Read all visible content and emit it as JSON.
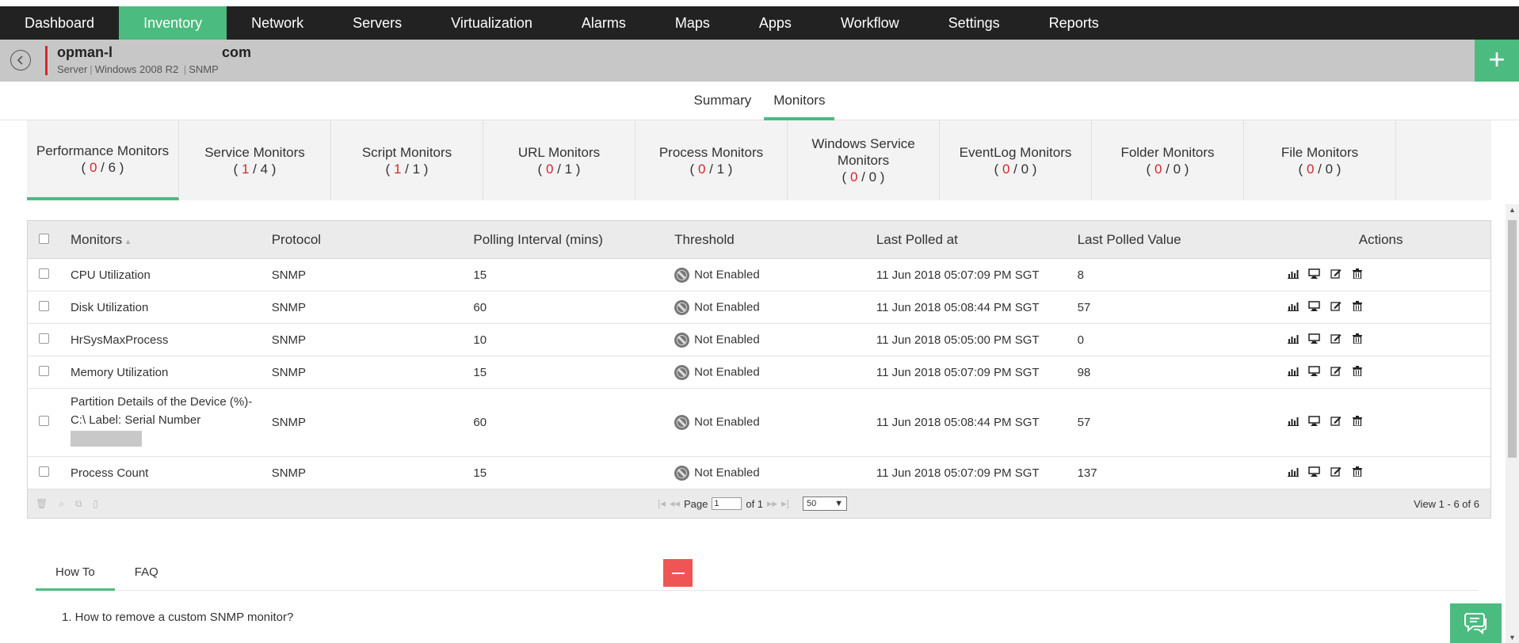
{
  "nav": [
    "Dashboard",
    "Inventory",
    "Network",
    "Servers",
    "Virtualization",
    "Alarms",
    "Maps",
    "Apps",
    "Workflow",
    "Settings",
    "Reports"
  ],
  "device": {
    "name_prefix": "opman-l",
    "name_suffix": "com",
    "type": "Server",
    "os": "Windows 2008 R2",
    "protocol": "SNMP"
  },
  "subtabs": [
    "Summary",
    "Monitors"
  ],
  "monitor_tabs": [
    {
      "label": "Performance Monitors",
      "active": "0",
      "total": "6"
    },
    {
      "label": "Service Monitors",
      "active": "1",
      "total": "4"
    },
    {
      "label": "Script Monitors",
      "active": "1",
      "total": "1"
    },
    {
      "label": "URL Monitors",
      "active": "0",
      "total": "1"
    },
    {
      "label": "Process Monitors",
      "active": "0",
      "total": "1"
    },
    {
      "label": "Windows Service Monitors",
      "active": "0",
      "total": "0"
    },
    {
      "label": "EventLog Monitors",
      "active": "0",
      "total": "0"
    },
    {
      "label": "Folder Monitors",
      "active": "0",
      "total": "0"
    },
    {
      "label": "File Monitors",
      "active": "0",
      "total": "0"
    }
  ],
  "table": {
    "headers": [
      "Monitors",
      "Protocol",
      "Polling Interval (mins)",
      "Threshold",
      "Last Polled at",
      "Last Polled Value",
      "Actions"
    ],
    "rows": [
      {
        "monitor": "CPU Utilization",
        "protocol": "SNMP",
        "interval": "15",
        "threshold": "Not Enabled",
        "polled_at": "11 Jun 2018 05:07:09 PM SGT",
        "value": "8"
      },
      {
        "monitor": "Disk Utilization",
        "protocol": "SNMP",
        "interval": "60",
        "threshold": "Not Enabled",
        "polled_at": "11 Jun 2018 05:08:44 PM SGT",
        "value": "57"
      },
      {
        "monitor": "HrSysMaxProcess",
        "protocol": "SNMP",
        "interval": "10",
        "threshold": "Not Enabled",
        "polled_at": "11 Jun 2018 05:05:00 PM SGT",
        "value": "0"
      },
      {
        "monitor": "Memory Utilization",
        "protocol": "SNMP",
        "interval": "15",
        "threshold": "Not Enabled",
        "polled_at": "11 Jun 2018 05:07:09 PM SGT",
        "value": "98"
      },
      {
        "monitor": "Partition Details of the Device (%)-C:\\ Label: Serial Number",
        "protocol": "SNMP",
        "interval": "60",
        "threshold": "Not Enabled",
        "polled_at": "11 Jun 2018 05:08:44 PM SGT",
        "value": "57"
      },
      {
        "monitor": "Process Count",
        "protocol": "SNMP",
        "interval": "15",
        "threshold": "Not Enabled",
        "polled_at": "11 Jun 2018 05:07:09 PM SGT",
        "value": "137"
      }
    ]
  },
  "pager": {
    "page_label": "Page",
    "page_value": "1",
    "of_label": "of 1",
    "page_size": "50",
    "view_text": "View 1 - 6 of 6"
  },
  "help": {
    "tabs": [
      "How To",
      "FAQ"
    ],
    "item1": "1. How to remove a custom SNMP monitor?"
  }
}
